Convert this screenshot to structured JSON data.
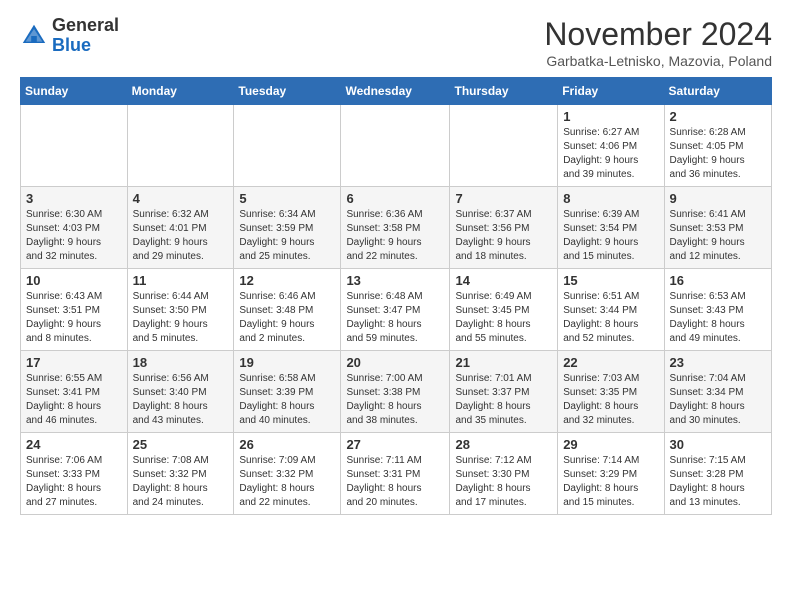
{
  "header": {
    "logo_general": "General",
    "logo_blue": "Blue",
    "month_title": "November 2024",
    "subtitle": "Garbatka-Letnisko, Mazovia, Poland"
  },
  "days_of_week": [
    "Sunday",
    "Monday",
    "Tuesday",
    "Wednesday",
    "Thursday",
    "Friday",
    "Saturday"
  ],
  "weeks": [
    [
      {
        "day": "",
        "info": ""
      },
      {
        "day": "",
        "info": ""
      },
      {
        "day": "",
        "info": ""
      },
      {
        "day": "",
        "info": ""
      },
      {
        "day": "",
        "info": ""
      },
      {
        "day": "1",
        "info": "Sunrise: 6:27 AM\nSunset: 4:06 PM\nDaylight: 9 hours\nand 39 minutes."
      },
      {
        "day": "2",
        "info": "Sunrise: 6:28 AM\nSunset: 4:05 PM\nDaylight: 9 hours\nand 36 minutes."
      }
    ],
    [
      {
        "day": "3",
        "info": "Sunrise: 6:30 AM\nSunset: 4:03 PM\nDaylight: 9 hours\nand 32 minutes."
      },
      {
        "day": "4",
        "info": "Sunrise: 6:32 AM\nSunset: 4:01 PM\nDaylight: 9 hours\nand 29 minutes."
      },
      {
        "day": "5",
        "info": "Sunrise: 6:34 AM\nSunset: 3:59 PM\nDaylight: 9 hours\nand 25 minutes."
      },
      {
        "day": "6",
        "info": "Sunrise: 6:36 AM\nSunset: 3:58 PM\nDaylight: 9 hours\nand 22 minutes."
      },
      {
        "day": "7",
        "info": "Sunrise: 6:37 AM\nSunset: 3:56 PM\nDaylight: 9 hours\nand 18 minutes."
      },
      {
        "day": "8",
        "info": "Sunrise: 6:39 AM\nSunset: 3:54 PM\nDaylight: 9 hours\nand 15 minutes."
      },
      {
        "day": "9",
        "info": "Sunrise: 6:41 AM\nSunset: 3:53 PM\nDaylight: 9 hours\nand 12 minutes."
      }
    ],
    [
      {
        "day": "10",
        "info": "Sunrise: 6:43 AM\nSunset: 3:51 PM\nDaylight: 9 hours\nand 8 minutes."
      },
      {
        "day": "11",
        "info": "Sunrise: 6:44 AM\nSunset: 3:50 PM\nDaylight: 9 hours\nand 5 minutes."
      },
      {
        "day": "12",
        "info": "Sunrise: 6:46 AM\nSunset: 3:48 PM\nDaylight: 9 hours\nand 2 minutes."
      },
      {
        "day": "13",
        "info": "Sunrise: 6:48 AM\nSunset: 3:47 PM\nDaylight: 8 hours\nand 59 minutes."
      },
      {
        "day": "14",
        "info": "Sunrise: 6:49 AM\nSunset: 3:45 PM\nDaylight: 8 hours\nand 55 minutes."
      },
      {
        "day": "15",
        "info": "Sunrise: 6:51 AM\nSunset: 3:44 PM\nDaylight: 8 hours\nand 52 minutes."
      },
      {
        "day": "16",
        "info": "Sunrise: 6:53 AM\nSunset: 3:43 PM\nDaylight: 8 hours\nand 49 minutes."
      }
    ],
    [
      {
        "day": "17",
        "info": "Sunrise: 6:55 AM\nSunset: 3:41 PM\nDaylight: 8 hours\nand 46 minutes."
      },
      {
        "day": "18",
        "info": "Sunrise: 6:56 AM\nSunset: 3:40 PM\nDaylight: 8 hours\nand 43 minutes."
      },
      {
        "day": "19",
        "info": "Sunrise: 6:58 AM\nSunset: 3:39 PM\nDaylight: 8 hours\nand 40 minutes."
      },
      {
        "day": "20",
        "info": "Sunrise: 7:00 AM\nSunset: 3:38 PM\nDaylight: 8 hours\nand 38 minutes."
      },
      {
        "day": "21",
        "info": "Sunrise: 7:01 AM\nSunset: 3:37 PM\nDaylight: 8 hours\nand 35 minutes."
      },
      {
        "day": "22",
        "info": "Sunrise: 7:03 AM\nSunset: 3:35 PM\nDaylight: 8 hours\nand 32 minutes."
      },
      {
        "day": "23",
        "info": "Sunrise: 7:04 AM\nSunset: 3:34 PM\nDaylight: 8 hours\nand 30 minutes."
      }
    ],
    [
      {
        "day": "24",
        "info": "Sunrise: 7:06 AM\nSunset: 3:33 PM\nDaylight: 8 hours\nand 27 minutes."
      },
      {
        "day": "25",
        "info": "Sunrise: 7:08 AM\nSunset: 3:32 PM\nDaylight: 8 hours\nand 24 minutes."
      },
      {
        "day": "26",
        "info": "Sunrise: 7:09 AM\nSunset: 3:32 PM\nDaylight: 8 hours\nand 22 minutes."
      },
      {
        "day": "27",
        "info": "Sunrise: 7:11 AM\nSunset: 3:31 PM\nDaylight: 8 hours\nand 20 minutes."
      },
      {
        "day": "28",
        "info": "Sunrise: 7:12 AM\nSunset: 3:30 PM\nDaylight: 8 hours\nand 17 minutes."
      },
      {
        "day": "29",
        "info": "Sunrise: 7:14 AM\nSunset: 3:29 PM\nDaylight: 8 hours\nand 15 minutes."
      },
      {
        "day": "30",
        "info": "Sunrise: 7:15 AM\nSunset: 3:28 PM\nDaylight: 8 hours\nand 13 minutes."
      }
    ]
  ]
}
